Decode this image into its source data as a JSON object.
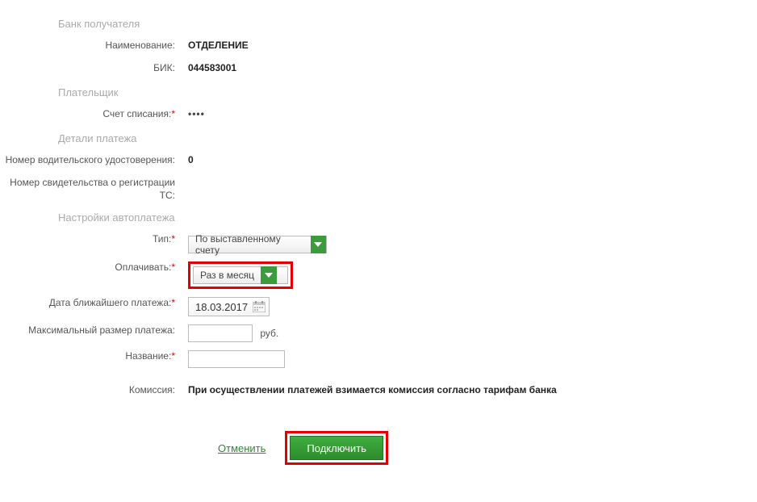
{
  "sections": {
    "bank": "Банк получателя",
    "payer": "Плательщик",
    "details": "Детали платежа",
    "settings": "Настройки автоплатежа"
  },
  "bank": {
    "name_label": "Наименование:",
    "name_value": "ОТДЕЛЕНИЕ",
    "bik_label": "БИК:",
    "bik_value": "044583001"
  },
  "payer": {
    "account_label": "Счет списания:",
    "account_value": "••••"
  },
  "details": {
    "license_label": "Номер водительского удостоверения:",
    "license_value": "0",
    "reg_label": "Номер свидетельства о регистрации ТС:",
    "reg_value": ""
  },
  "settings": {
    "type_label": "Тип:",
    "type_value": "По выставленному счету",
    "pay_label": "Оплачивать:",
    "pay_value": "Раз в месяц",
    "date_label": "Дата ближайшего платежа:",
    "date_value": "18.03.2017",
    "max_label": "Максимальный размер платежа:",
    "max_value": "",
    "max_unit": "руб.",
    "name_label": "Название:",
    "name_value": "",
    "commission_label": "Комиссия:",
    "commission_value": "При осуществлении платежей взимается комиссия согласно тарифам банка"
  },
  "actions": {
    "cancel": "Отменить",
    "submit": "Подключить"
  }
}
